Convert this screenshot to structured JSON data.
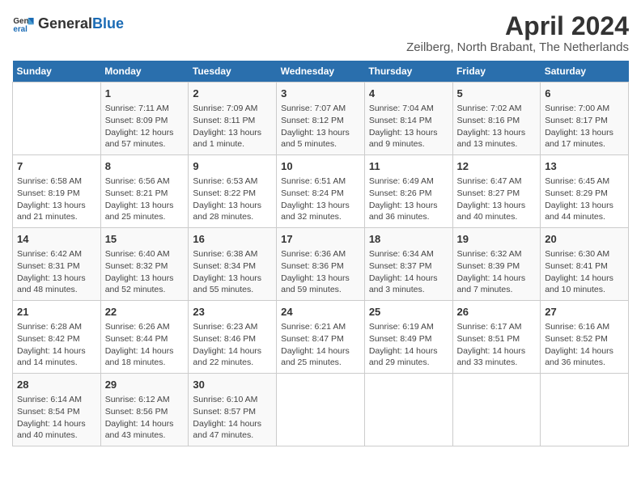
{
  "header": {
    "logo_general": "General",
    "logo_blue": "Blue",
    "title": "April 2024",
    "subtitle": "Zeilberg, North Brabant, The Netherlands"
  },
  "weekdays": [
    "Sunday",
    "Monday",
    "Tuesday",
    "Wednesday",
    "Thursday",
    "Friday",
    "Saturday"
  ],
  "weeks": [
    [
      {
        "day": "",
        "info": ""
      },
      {
        "day": "1",
        "info": "Sunrise: 7:11 AM\nSunset: 8:09 PM\nDaylight: 12 hours\nand 57 minutes."
      },
      {
        "day": "2",
        "info": "Sunrise: 7:09 AM\nSunset: 8:11 PM\nDaylight: 13 hours\nand 1 minute."
      },
      {
        "day": "3",
        "info": "Sunrise: 7:07 AM\nSunset: 8:12 PM\nDaylight: 13 hours\nand 5 minutes."
      },
      {
        "day": "4",
        "info": "Sunrise: 7:04 AM\nSunset: 8:14 PM\nDaylight: 13 hours\nand 9 minutes."
      },
      {
        "day": "5",
        "info": "Sunrise: 7:02 AM\nSunset: 8:16 PM\nDaylight: 13 hours\nand 13 minutes."
      },
      {
        "day": "6",
        "info": "Sunrise: 7:00 AM\nSunset: 8:17 PM\nDaylight: 13 hours\nand 17 minutes."
      }
    ],
    [
      {
        "day": "7",
        "info": "Sunrise: 6:58 AM\nSunset: 8:19 PM\nDaylight: 13 hours\nand 21 minutes."
      },
      {
        "day": "8",
        "info": "Sunrise: 6:56 AM\nSunset: 8:21 PM\nDaylight: 13 hours\nand 25 minutes."
      },
      {
        "day": "9",
        "info": "Sunrise: 6:53 AM\nSunset: 8:22 PM\nDaylight: 13 hours\nand 28 minutes."
      },
      {
        "day": "10",
        "info": "Sunrise: 6:51 AM\nSunset: 8:24 PM\nDaylight: 13 hours\nand 32 minutes."
      },
      {
        "day": "11",
        "info": "Sunrise: 6:49 AM\nSunset: 8:26 PM\nDaylight: 13 hours\nand 36 minutes."
      },
      {
        "day": "12",
        "info": "Sunrise: 6:47 AM\nSunset: 8:27 PM\nDaylight: 13 hours\nand 40 minutes."
      },
      {
        "day": "13",
        "info": "Sunrise: 6:45 AM\nSunset: 8:29 PM\nDaylight: 13 hours\nand 44 minutes."
      }
    ],
    [
      {
        "day": "14",
        "info": "Sunrise: 6:42 AM\nSunset: 8:31 PM\nDaylight: 13 hours\nand 48 minutes."
      },
      {
        "day": "15",
        "info": "Sunrise: 6:40 AM\nSunset: 8:32 PM\nDaylight: 13 hours\nand 52 minutes."
      },
      {
        "day": "16",
        "info": "Sunrise: 6:38 AM\nSunset: 8:34 PM\nDaylight: 13 hours\nand 55 minutes."
      },
      {
        "day": "17",
        "info": "Sunrise: 6:36 AM\nSunset: 8:36 PM\nDaylight: 13 hours\nand 59 minutes."
      },
      {
        "day": "18",
        "info": "Sunrise: 6:34 AM\nSunset: 8:37 PM\nDaylight: 14 hours\nand 3 minutes."
      },
      {
        "day": "19",
        "info": "Sunrise: 6:32 AM\nSunset: 8:39 PM\nDaylight: 14 hours\nand 7 minutes."
      },
      {
        "day": "20",
        "info": "Sunrise: 6:30 AM\nSunset: 8:41 PM\nDaylight: 14 hours\nand 10 minutes."
      }
    ],
    [
      {
        "day": "21",
        "info": "Sunrise: 6:28 AM\nSunset: 8:42 PM\nDaylight: 14 hours\nand 14 minutes."
      },
      {
        "day": "22",
        "info": "Sunrise: 6:26 AM\nSunset: 8:44 PM\nDaylight: 14 hours\nand 18 minutes."
      },
      {
        "day": "23",
        "info": "Sunrise: 6:23 AM\nSunset: 8:46 PM\nDaylight: 14 hours\nand 22 minutes."
      },
      {
        "day": "24",
        "info": "Sunrise: 6:21 AM\nSunset: 8:47 PM\nDaylight: 14 hours\nand 25 minutes."
      },
      {
        "day": "25",
        "info": "Sunrise: 6:19 AM\nSunset: 8:49 PM\nDaylight: 14 hours\nand 29 minutes."
      },
      {
        "day": "26",
        "info": "Sunrise: 6:17 AM\nSunset: 8:51 PM\nDaylight: 14 hours\nand 33 minutes."
      },
      {
        "day": "27",
        "info": "Sunrise: 6:16 AM\nSunset: 8:52 PM\nDaylight: 14 hours\nand 36 minutes."
      }
    ],
    [
      {
        "day": "28",
        "info": "Sunrise: 6:14 AM\nSunset: 8:54 PM\nDaylight: 14 hours\nand 40 minutes."
      },
      {
        "day": "29",
        "info": "Sunrise: 6:12 AM\nSunset: 8:56 PM\nDaylight: 14 hours\nand 43 minutes."
      },
      {
        "day": "30",
        "info": "Sunrise: 6:10 AM\nSunset: 8:57 PM\nDaylight: 14 hours\nand 47 minutes."
      },
      {
        "day": "",
        "info": ""
      },
      {
        "day": "",
        "info": ""
      },
      {
        "day": "",
        "info": ""
      },
      {
        "day": "",
        "info": ""
      }
    ]
  ]
}
